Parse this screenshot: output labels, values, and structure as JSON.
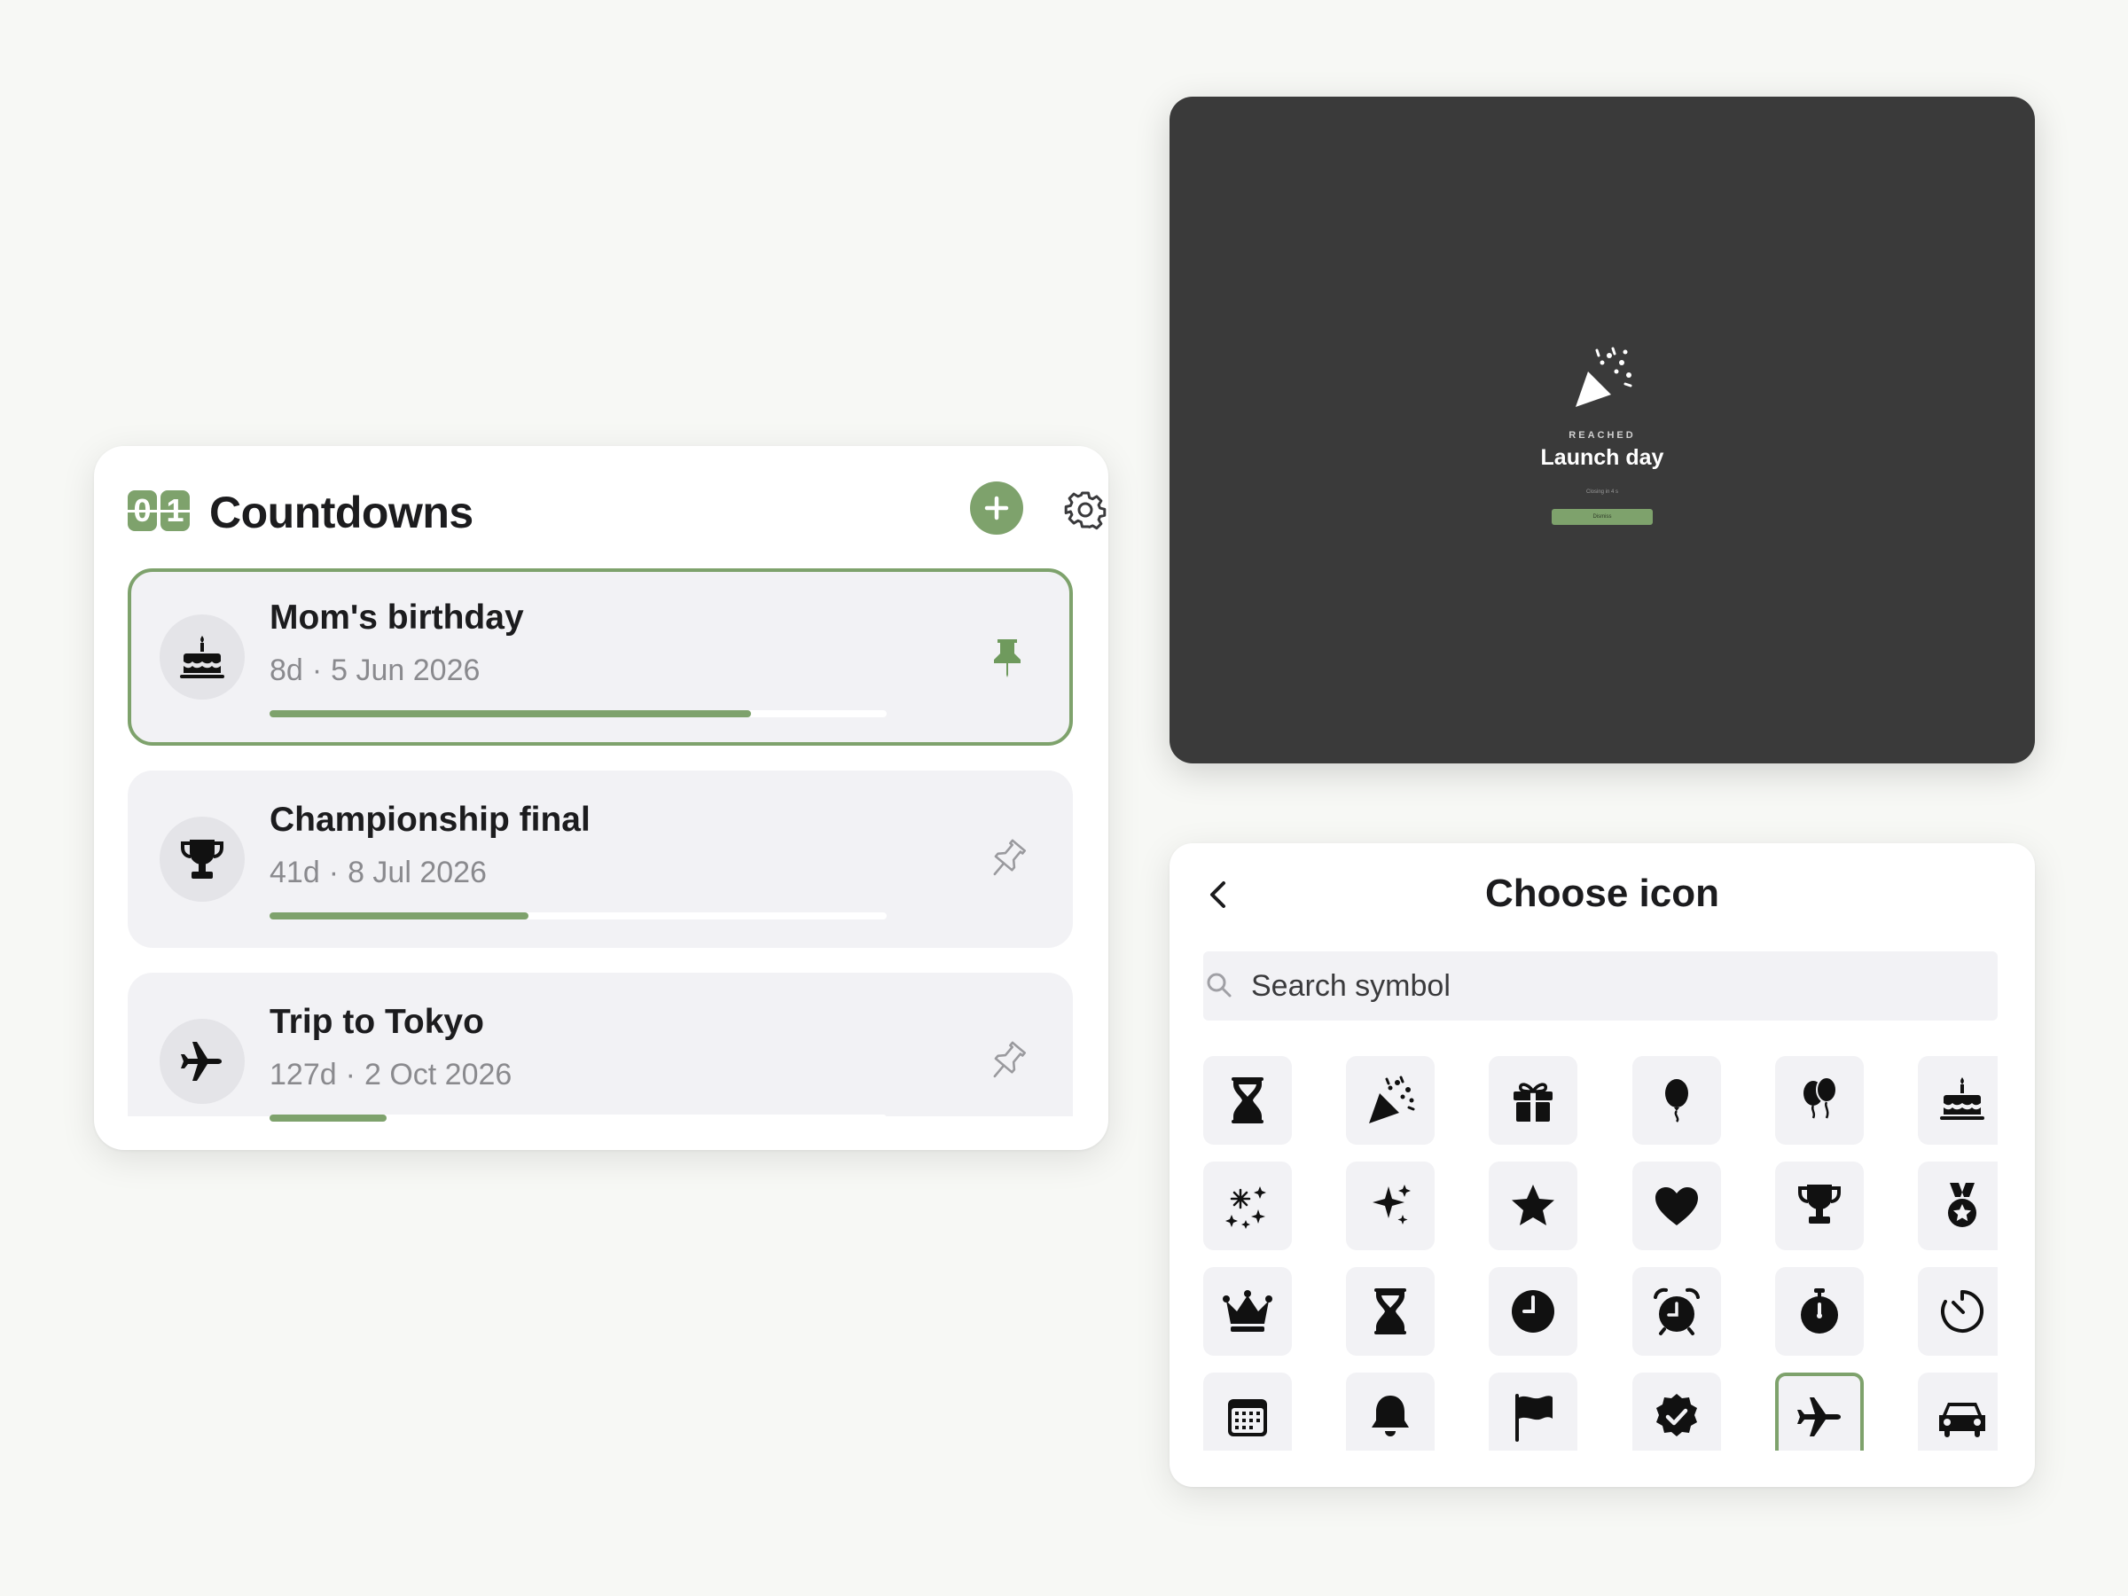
{
  "countdowns": {
    "logo_digits": [
      "0",
      "1"
    ],
    "title": "Countdowns",
    "items": [
      {
        "name": "Mom's birthday",
        "days": "8d",
        "date": "5 Jun 2026",
        "icon": "birthday-cake-icon",
        "pinned": true,
        "progress": 0.78
      },
      {
        "name": "Championship final",
        "days": "41d",
        "date": "8 Jul 2026",
        "icon": "trophy-icon",
        "pinned": false,
        "progress": 0.42
      },
      {
        "name": "Trip to Tokyo",
        "days": "127d",
        "date": "2 Oct 2026",
        "icon": "airplane-icon",
        "pinned": false,
        "progress": 0.19
      }
    ],
    "meta_separator": "·"
  },
  "reached": {
    "kicker": "REACHED",
    "title": "Launch day",
    "closing_text": "Closing in 4 s",
    "dismiss_label": "Dismiss"
  },
  "chooser": {
    "title": "Choose icon",
    "search_placeholder": "Search symbol",
    "icons": [
      "hourglass-icon",
      "party-popper-icon",
      "gift-icon",
      "balloon-icon",
      "balloons-icon",
      "birthday-cake-icon",
      "fireworks-icon",
      "sparkles-icon",
      "star-icon",
      "heart-icon",
      "trophy-icon",
      "medal-icon",
      "crown-icon",
      "hourglass-icon",
      "clock-icon",
      "alarm-clock-icon",
      "stopwatch-icon",
      "timer-icon",
      "calendar-icon",
      "bell-icon",
      "flag-icon",
      "verified-badge-icon",
      "airplane-icon",
      "car-icon"
    ],
    "selected_icon": "airplane-icon"
  },
  "colors": {
    "accent": "#7ea26c",
    "card_bg": "#f2f2f5",
    "overlay_bg": "#3a3a3a",
    "page_bg": "#f7f8f5"
  }
}
